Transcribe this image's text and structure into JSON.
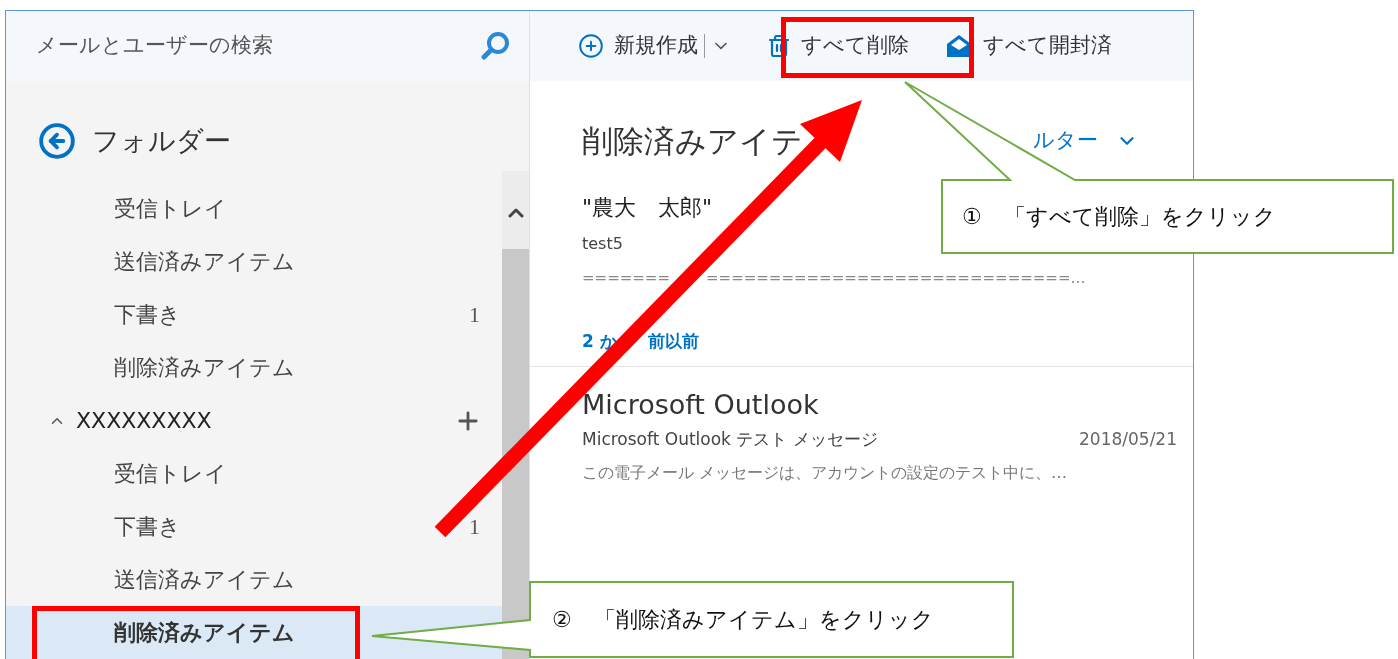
{
  "search": {
    "placeholder": "メールとユーザーの検索"
  },
  "folder_header": {
    "title": "フォルダー"
  },
  "folders": [
    {
      "label": "受信トレイ",
      "selected": false
    },
    {
      "label": "送信済みアイテム",
      "selected": false
    },
    {
      "label": "下書き",
      "count": "1",
      "selected": false
    },
    {
      "label": "削除済みアイテム",
      "selected": false
    }
  ],
  "account": {
    "name": "XXXXXXXXX",
    "expanded": true,
    "children": [
      {
        "label": "受信トレイ",
        "selected": false
      },
      {
        "label": "下書き",
        "count": "1",
        "selected": false
      },
      {
        "label": "送信済みアイテム",
        "selected": false
      },
      {
        "label": "削除済みアイテム",
        "selected": true
      }
    ]
  },
  "toolbar": [
    {
      "kind": "new",
      "label": "新規作成"
    },
    {
      "kind": "delete_all",
      "label": "すべて削除"
    },
    {
      "kind": "mark_read",
      "label": "すべて開封済"
    }
  ],
  "list": {
    "title": "削除済みアイテ",
    "filter": "ルター",
    "top_messages": [
      {
        "sender": "\"農大　太郎\"",
        "subject": "test5",
        "preview": [
          "=======",
          "=============================…"
        ]
      }
    ],
    "group_label": [
      "2 か",
      "前以前"
    ],
    "messages": [
      {
        "sender": "Microsoft Outlook",
        "subject": "Microsoft Outlook テスト メッセージ",
        "date": "2018/05/21",
        "preview": "この電子メール メッセージは、アカウントの設定のテスト中に、…"
      }
    ]
  },
  "annotations": [
    {
      "number": "①",
      "text": "「すべて削除」をクリック"
    },
    {
      "number": "②",
      "text": "「削除済みアイテム」をクリック"
    }
  ]
}
